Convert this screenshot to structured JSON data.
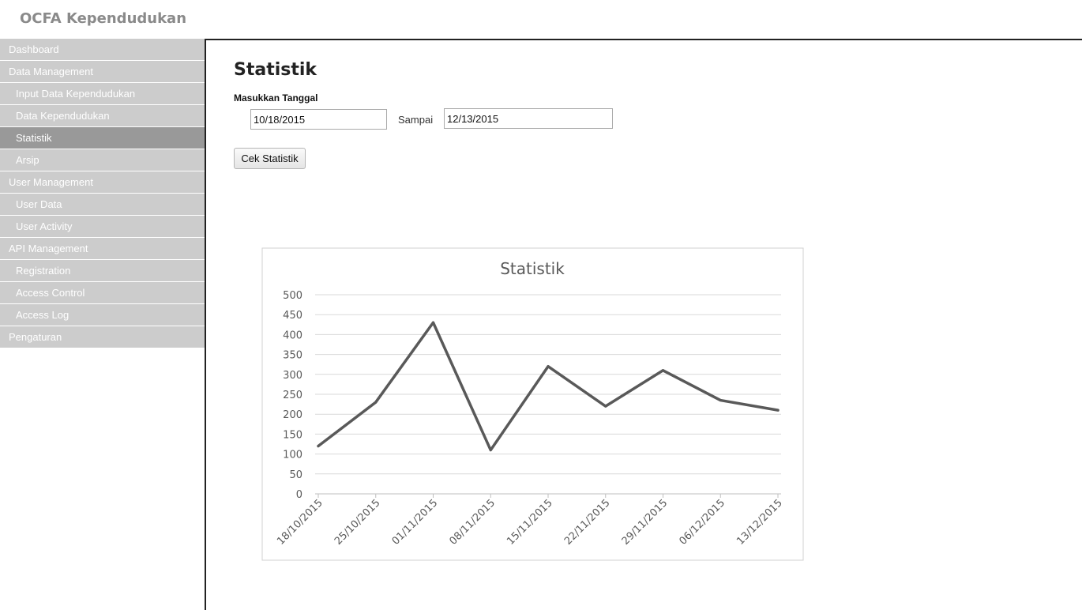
{
  "header": {
    "app_title": "OCFA Kependudukan"
  },
  "sidebar": {
    "items": [
      {
        "label": "Dashboard",
        "level": 0,
        "active": false
      },
      {
        "label": "Data Management",
        "level": 0,
        "active": false
      },
      {
        "label": "Input Data Kependudukan",
        "level": 1,
        "active": false
      },
      {
        "label": "Data Kependudukan",
        "level": 1,
        "active": false
      },
      {
        "label": "Statistik",
        "level": 1,
        "active": true
      },
      {
        "label": "Arsip",
        "level": 1,
        "active": false
      },
      {
        "label": "User Management",
        "level": 0,
        "active": false
      },
      {
        "label": "User Data",
        "level": 1,
        "active": false
      },
      {
        "label": "User Activity",
        "level": 1,
        "active": false
      },
      {
        "label": "API Management",
        "level": 0,
        "active": false
      },
      {
        "label": "Registration",
        "level": 1,
        "active": false
      },
      {
        "label": "Access Control",
        "level": 1,
        "active": false
      },
      {
        "label": "Access Log",
        "level": 1,
        "active": false
      },
      {
        "label": "Pengaturan",
        "level": 0,
        "active": false
      }
    ]
  },
  "main": {
    "title": "Statistik",
    "date_label": "Masukkan Tanggal",
    "from_value": "10/18/2015",
    "separator": "Sampai",
    "to_value": "12/13/2015",
    "button_label": "Cek Statistik"
  },
  "colors": {
    "nav_bg": "#cccccc",
    "nav_active_bg": "#999999",
    "line_color": "#595959",
    "grid_color": "#d9d9d9"
  },
  "chart_data": {
    "type": "line",
    "title": "Statistik",
    "categories": [
      "18/10/2015",
      "25/10/2015",
      "01/11/2015",
      "08/11/2015",
      "15/11/2015",
      "22/11/2015",
      "29/11/2015",
      "06/12/2015",
      "13/12/2015"
    ],
    "values": [
      120,
      230,
      430,
      110,
      320,
      220,
      310,
      235,
      210
    ],
    "ylim": [
      0,
      500
    ],
    "yticks": [
      0,
      50,
      100,
      150,
      200,
      250,
      300,
      350,
      400,
      450,
      500
    ],
    "grid": true,
    "legend": "none"
  }
}
